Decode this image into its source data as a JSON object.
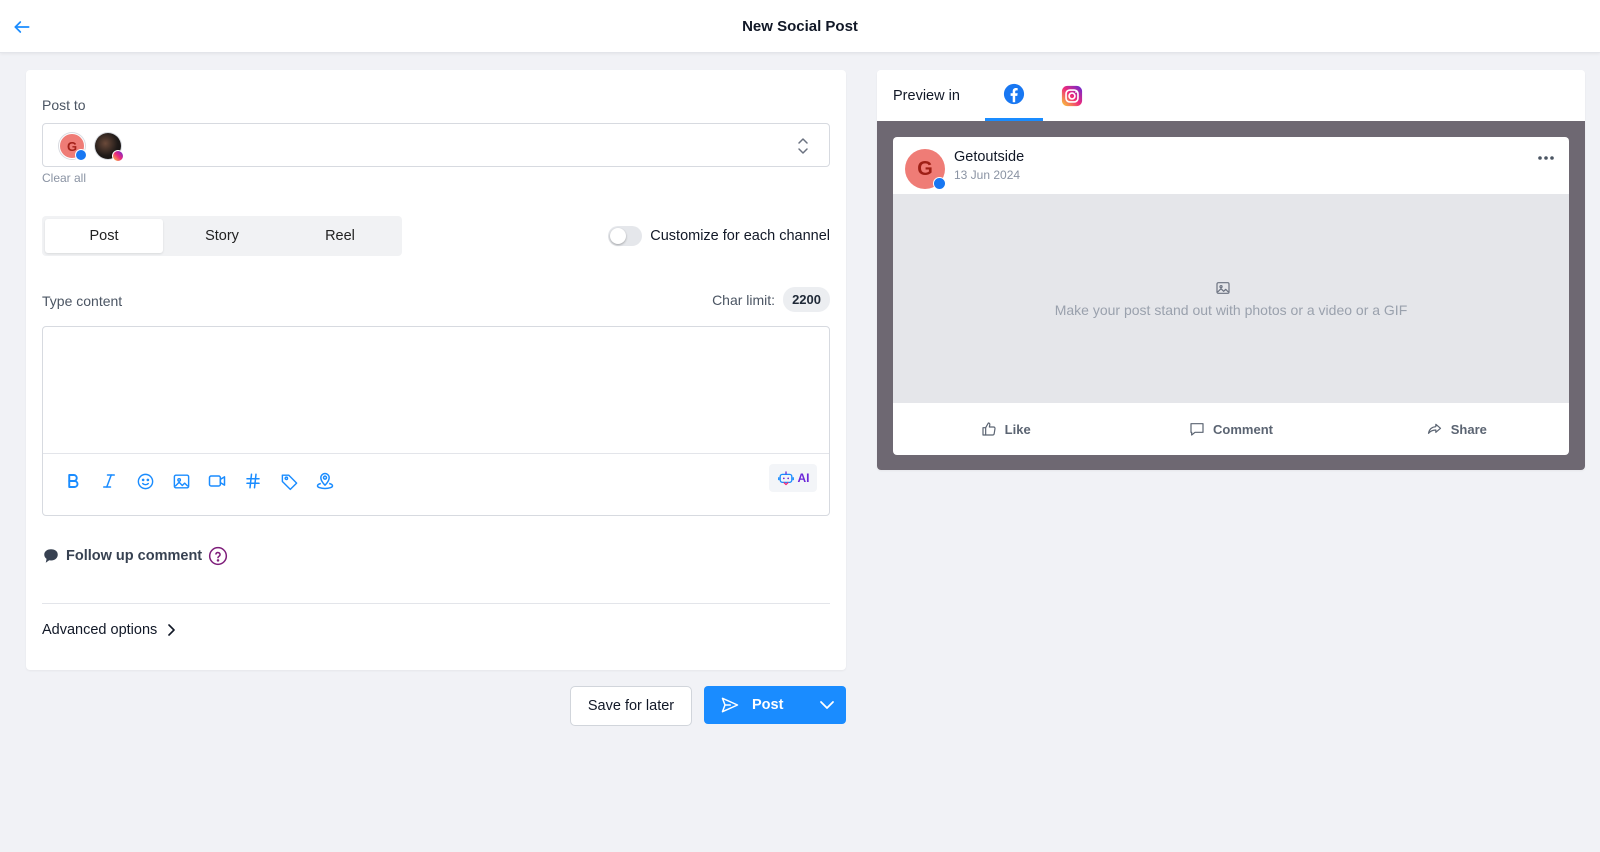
{
  "header": {
    "title": "New Social Post"
  },
  "composer": {
    "post_to_label": "Post to",
    "accounts": [
      {
        "name": "Getoutside",
        "initial": "G",
        "network": "facebook"
      },
      {
        "name": "Instagram account",
        "network": "instagram"
      }
    ],
    "clear_all": "Clear all",
    "post_types": [
      "Post",
      "Story",
      "Reel"
    ],
    "selected_post_type": "Post",
    "customize_label": "Customize for each channel",
    "customize_enabled": false,
    "content_label": "Type content",
    "char_limit_label": "Char limit:",
    "char_limit_value": "2200",
    "content_value": "",
    "toolbar_icons": [
      "bold-icon",
      "italic-icon",
      "emoji-icon",
      "image-icon",
      "video-icon",
      "hashtag-icon",
      "tag-icon",
      "location-icon"
    ],
    "ai_label": "AI",
    "follow_up_label": "Follow up comment",
    "advanced_label": "Advanced options"
  },
  "actions": {
    "save_later": "Save for later",
    "post": "Post"
  },
  "preview": {
    "label": "Preview in",
    "tabs": [
      "facebook",
      "instagram"
    ],
    "active_tab": "facebook",
    "author_initial": "G",
    "author": "Getoutside",
    "date": "13 Jun 2024",
    "media_placeholder": "Make your post stand out with photos or a video or a GIF",
    "actions": [
      "Like",
      "Comment",
      "Share"
    ]
  },
  "colors": {
    "accent": "#1a8cff",
    "avatar": "#ef7c76",
    "preview_backdrop": "#6e6872",
    "ai": "#6d28d9",
    "follow_up_help": "#7e1d7a"
  }
}
